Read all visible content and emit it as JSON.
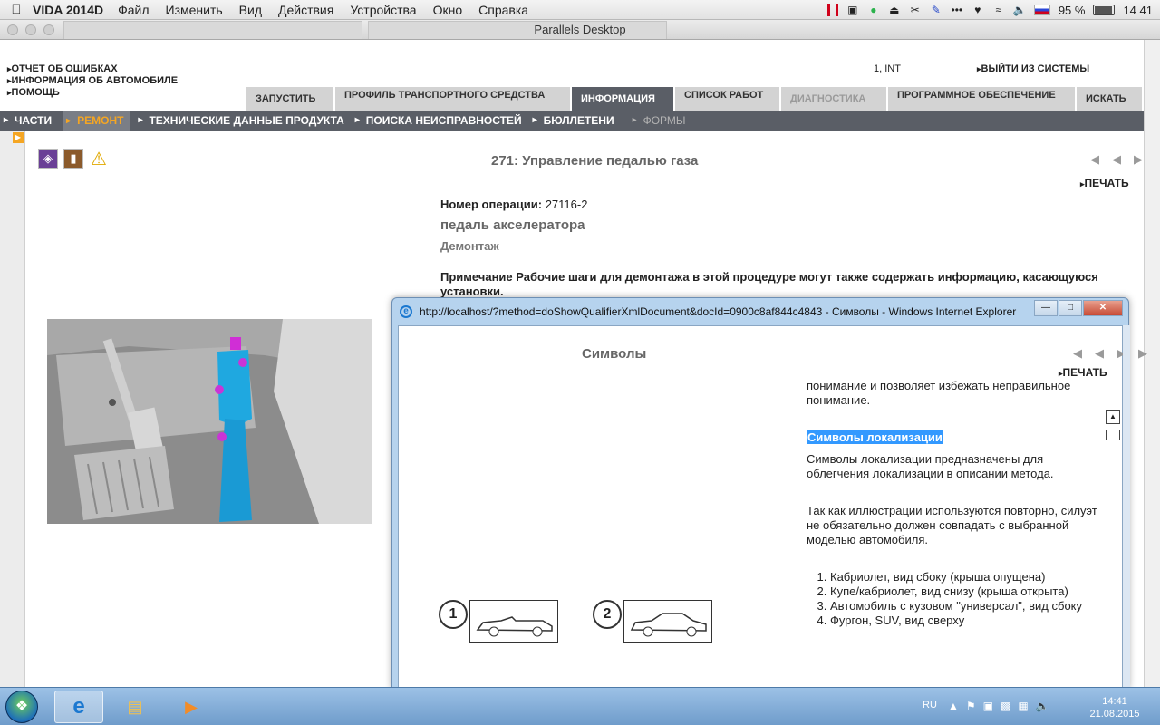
{
  "mac": {
    "app_name": "VIDA 2014D",
    "menus": [
      "Файл",
      "Изменить",
      "Вид",
      "Действия",
      "Устройства",
      "Окно",
      "Справка"
    ],
    "battery": "95 %",
    "time": "14 41"
  },
  "parallels": {
    "title": "Parallels Desktop"
  },
  "vida": {
    "top_links": [
      "ОТЧЕТ ОБ ОШИБКАХ",
      "ИНФОРМАЦИЯ ОБ АВТОМОБИЛЕ",
      "ПОМОЩЬ"
    ],
    "user": "1, INT",
    "logout": "ВЫЙТИ ИЗ СИСТЕМЫ",
    "tabs": [
      {
        "label": "ЗАПУСТИТЬ"
      },
      {
        "label": "ПРОФИЛЬ ТРАНСПОРТНОГО СРЕДСТВА"
      },
      {
        "label": "ИНФОРМАЦИЯ"
      },
      {
        "label": "СПИСОК РАБОТ"
      },
      {
        "label": "ДИАГНОСТИКА"
      },
      {
        "label": "ПРОГРАММНОЕ ОБЕСПЕЧЕНИЕ"
      },
      {
        "label": "ИСКАТЬ"
      }
    ],
    "subnav": [
      "ЧАСТИ",
      "РЕМОНТ",
      "ТЕХНИЧЕСКИЕ ДАННЫЕ ПРОДУКТА",
      "ПОИСКА НЕИСПРАВНОСТЕЙ",
      "БЮЛЛЕТЕНИ",
      "ФОРМЫ"
    ],
    "doc_title": "271: Управление педалью газа",
    "print": "ПЕЧАТЬ",
    "op_label": "Номер операции:",
    "op_value": "27116-2",
    "part": "педаль акселератора",
    "procedure": "Демонтаж",
    "note": "Примечание Рабочие шаги для демонтажа в этой процедуре могут также содержать информацию, касающуюся установки."
  },
  "ie": {
    "title": "http://localhost/?method=doShowQualifierXmlDocument&docId=0900c8af844c4843 - Символы - Windows Internet Explorer",
    "heading": "Символы",
    "print": "ПЕЧАТЬ",
    "para1": "понимание и позволяет избежать неправильное понимание.",
    "section_title": "Символы локализации",
    "para2": "Символы локализации предназначены для облегчения локализации в описании метода.",
    "para3": "Так как иллюстрации используются повторно, силуэт не обязательно должен совпадать с выбранной моделью автомобиля.",
    "list": [
      "Кабриолет, вид сбоку (крыша опущена)",
      "Купе/кабриолет, вид снизу (крыша открыта)",
      "Автомобиль с кузовом \"универсал\", вид сбоку",
      "Фургон, SUV, вид сверху"
    ],
    "car_labels": [
      "1",
      "2"
    ]
  },
  "taskbar": {
    "lang": "RU",
    "time": "14:41",
    "date": "21.08.2015"
  },
  "colors": {
    "tab_active": "#5a5e66",
    "subnav_active_text": "#f5a623",
    "selection": "#3399ff"
  }
}
